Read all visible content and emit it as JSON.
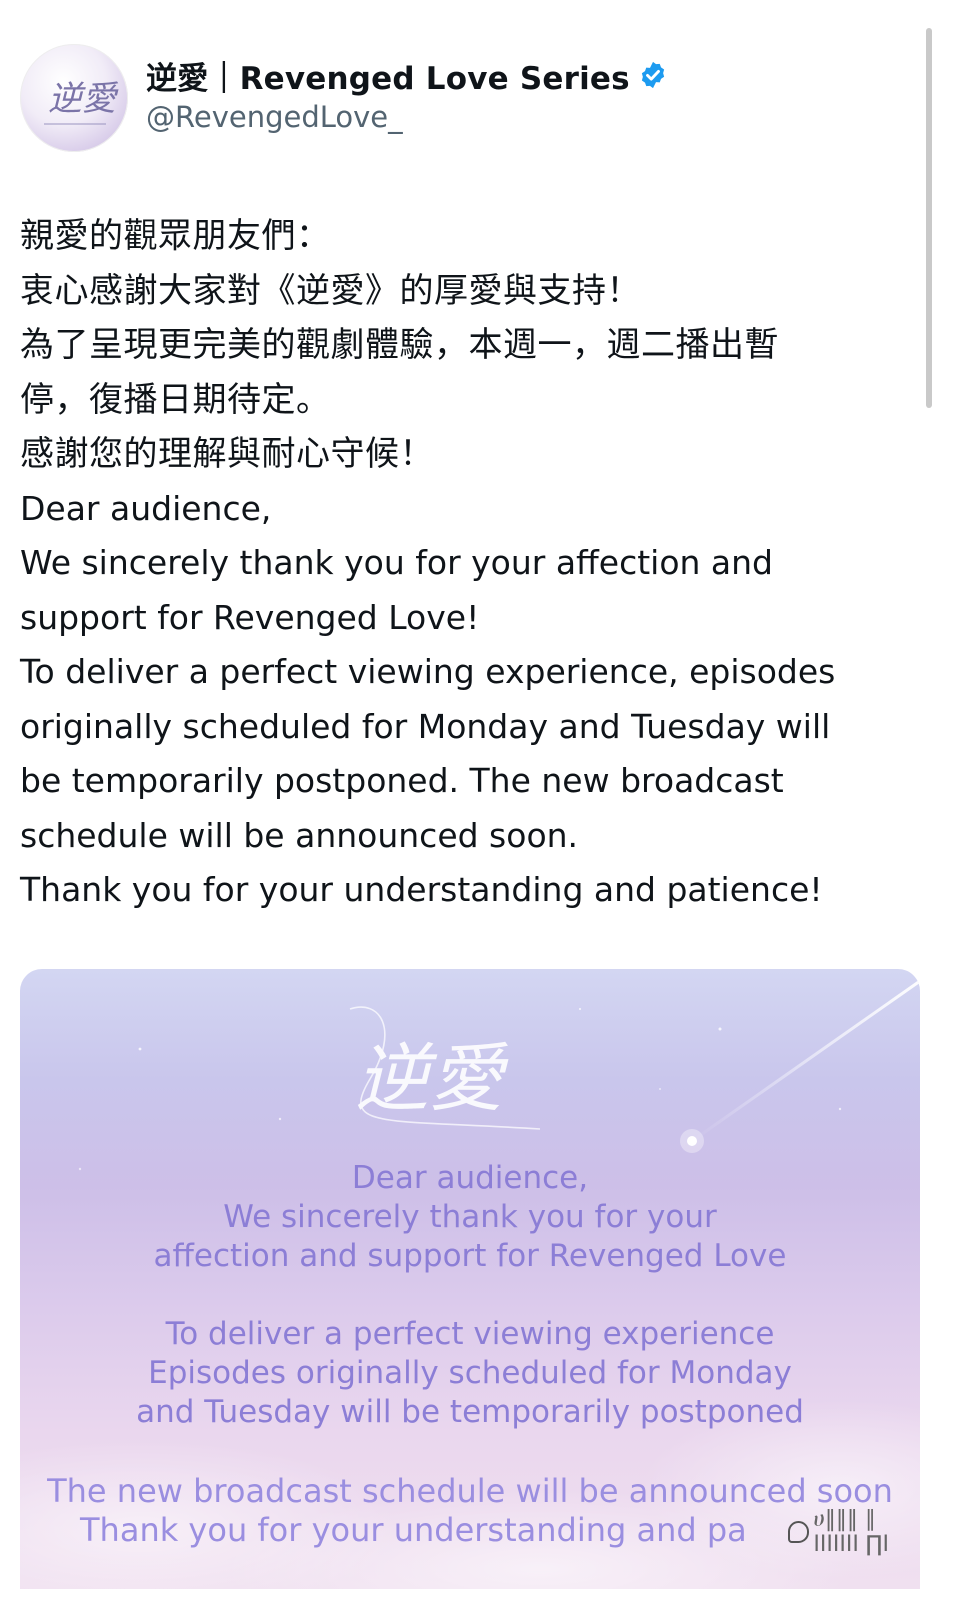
{
  "profile": {
    "display_name": "逆愛｜Revenged Love Series",
    "handle": "@RevengedLove_",
    "verified": true,
    "avatar_text": "逆愛"
  },
  "tweet": {
    "lines": [
      "親愛的觀眾朋友們：",
      "衷心感謝大家對《逆愛》的厚愛與支持！",
      "為了呈現更完美的觀劇體驗，本週一，週二播出暫",
      "停，復播日期待定。",
      "感謝您的理解與耐心守候！",
      "Dear audience,",
      "We sincerely thank you for your affection and",
      "support for Revenged Love!",
      "To deliver a perfect viewing experience, episodes",
      "originally scheduled for Monday and Tuesday will",
      "be temporarily postponed. The new broadcast",
      "schedule will be announced soon.",
      "Thank you for your understanding and patience!"
    ]
  },
  "media": {
    "logo_text": "逆愛",
    "block1": [
      "Dear audience,",
      "We sincerely thank you for your",
      "affection and support for Revenged Love"
    ],
    "block2": [
      "To deliver a perfect viewing experience",
      "Episodes originally scheduled for Monday",
      "and Tuesday will be temporarily postponed"
    ],
    "block3": [
      "The new broadcast schedule will be announced soon",
      "Thank you for your understanding and pa"
    ]
  },
  "watermark": {
    "text": "ሀ‖‖‖ ∥ IIIIIII ∏I"
  },
  "colors": {
    "verified_blue": "#1d9bf0",
    "handle_gray": "#536471",
    "media_text": "#8c7ed6"
  },
  "icons": {
    "verified": "verified-badge-icon",
    "watermark": "chat-bubble-icon"
  }
}
